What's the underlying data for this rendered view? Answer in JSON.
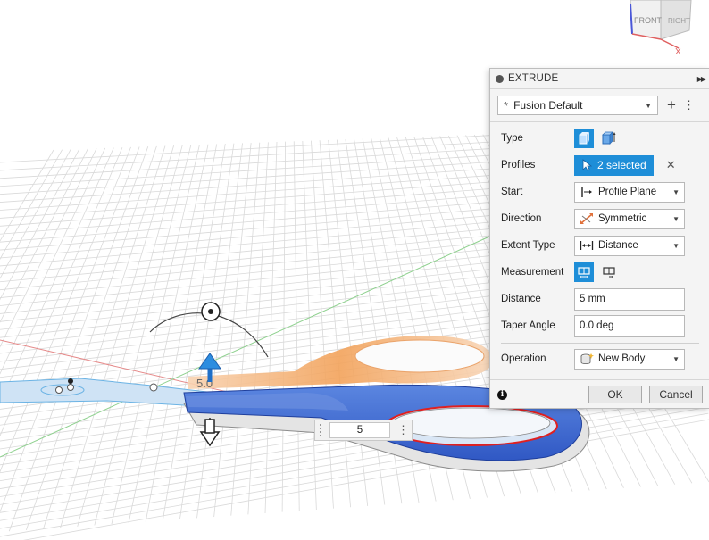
{
  "panel": {
    "title": "EXTRUDE",
    "preset": "Fusion Default",
    "rows": {
      "type": "Type",
      "profiles": "Profiles",
      "profiles_value": "2 selected",
      "start": "Start",
      "start_value": "Profile Plane",
      "direction": "Direction",
      "direction_value": "Symmetric",
      "extent_type": "Extent Type",
      "extent_value": "Distance",
      "measurement": "Measurement",
      "distance": "Distance",
      "distance_value": "5 mm",
      "taper": "Taper Angle",
      "taper_value": "0.0 deg",
      "operation": "Operation",
      "operation_value": "New Body"
    },
    "ok": "OK",
    "cancel": "Cancel"
  },
  "viewcube": {
    "front": "FRONT",
    "right": "RIGHT",
    "axis": "X"
  },
  "canvas": {
    "dimension_value": "5",
    "ghost_label": "5.0"
  },
  "colors": {
    "accent": "#1e8ed8",
    "body_blue": "#3d6fd6",
    "profile_orange": "#f5a35c",
    "selection_red": "#e02020"
  }
}
